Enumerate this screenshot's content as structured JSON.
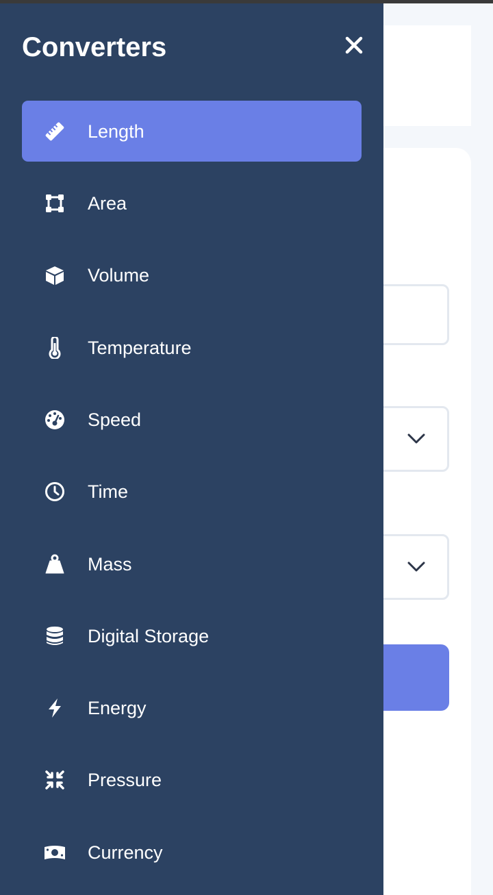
{
  "drawer": {
    "title": "Converters",
    "close_label": "Close",
    "items": [
      {
        "label": "Length",
        "icon": "ruler-icon",
        "active": true
      },
      {
        "label": "Area",
        "icon": "vector-square-icon",
        "active": false
      },
      {
        "label": "Volume",
        "icon": "cube-icon",
        "active": false
      },
      {
        "label": "Temperature",
        "icon": "thermometer-icon",
        "active": false
      },
      {
        "label": "Speed",
        "icon": "gauge-icon",
        "active": false
      },
      {
        "label": "Time",
        "icon": "clock-icon",
        "active": false
      },
      {
        "label": "Mass",
        "icon": "weight-icon",
        "active": false
      },
      {
        "label": "Digital Storage",
        "icon": "database-icon",
        "active": false
      },
      {
        "label": "Energy",
        "icon": "bolt-icon",
        "active": false
      },
      {
        "label": "Pressure",
        "icon": "compress-icon",
        "active": false
      },
      {
        "label": "Currency",
        "icon": "money-bill-icon",
        "active": false
      }
    ]
  },
  "colors": {
    "drawer_bg": "#2c4262",
    "accent": "#6a7fe6",
    "page_bg": "#f4f7fb"
  }
}
